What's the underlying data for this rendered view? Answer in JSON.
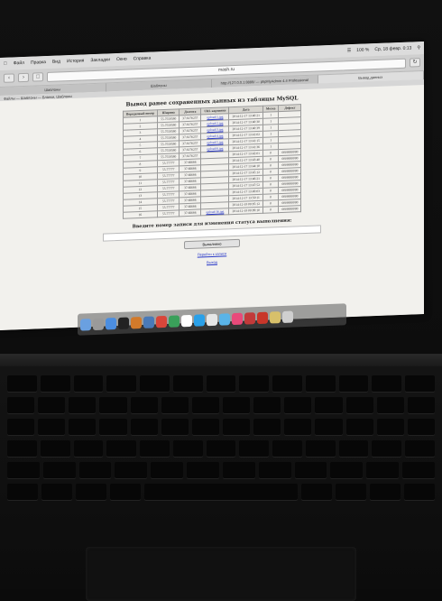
{
  "menubar": {
    "items": [
      "Файл",
      "Правка",
      "Вид",
      "История",
      "Закладки",
      "Окно",
      "Справка"
    ],
    "battery": "100 %",
    "clock": "Ср, 18 февр. 0:13"
  },
  "browser": {
    "address": "mash.ru",
    "tabs": [
      "Шаблоны",
      "Шаблоны",
      "http://127.0.0.1:8888/ — phpMyAdmin 4.4 Professional",
      "Вывод данных"
    ],
    "favorites": "Файлы — Шаблоны — Бланки, Шаблоны"
  },
  "page": {
    "title": "Вывод ранее сохраненных данных из таблицы MySQL",
    "columns": [
      "Порядковый номер",
      "Ширина",
      "Долгота",
      "URL картинки",
      "Дата",
      "Метка",
      "Дефект"
    ],
    "rows": [
      {
        "id": "1",
        "lat": "55.7558580",
        "lon": "37.6176257",
        "url": "upload/1.jpg",
        "date": "2014-12-17 13:40:21",
        "mark": "1",
        "def": ""
      },
      {
        "id": "2",
        "lat": "55.7558580",
        "lon": "37.6176257",
        "url": "upload/2.jpg",
        "date": "2014-12-17 13:40:30",
        "mark": "1",
        "def": ""
      },
      {
        "id": "3",
        "lat": "55.7558580",
        "lon": "37.6176257",
        "url": "upload/3.jpg",
        "date": "2014-12-17 13:40:39",
        "mark": "1",
        "def": ""
      },
      {
        "id": "4",
        "lat": "55.7558580",
        "lon": "37.6176257",
        "url": "upload/4.jpg",
        "date": "2014-12-17 13:41:02",
        "mark": "1",
        "def": ""
      },
      {
        "id": "5",
        "lat": "55.7558580",
        "lon": "37.6176257",
        "url": "upload/5.jpg",
        "date": "2014-12-17 13:41:15",
        "mark": "1",
        "def": ""
      },
      {
        "id": "6",
        "lat": "55.7558580",
        "lon": "37.6176257",
        "url": "upload/6.jpg",
        "date": "2014-12-17 13:41:36",
        "mark": "1",
        "def": ""
      },
      {
        "id": "7",
        "lat": "55.7558580",
        "lon": "37.6176257",
        "url": "",
        "date": "2014-12-17 13:42:01",
        "mark": "0",
        "def": "0000000000"
      },
      {
        "id": "8",
        "lat": "55.77777",
        "lon": "37.66666",
        "url": "",
        "date": "2014-12-17 13:43:40",
        "mark": "0",
        "def": "0000000000"
      },
      {
        "id": "9",
        "lat": "55.77777",
        "lon": "37.66666",
        "url": "",
        "date": "2014-12-17 13:44:10",
        "mark": "0",
        "def": "0000000000"
      },
      {
        "id": "10",
        "lat": "55.77777",
        "lon": "37.66666",
        "url": "",
        "date": "2014-12-17 13:45:12",
        "mark": "0",
        "def": "0000000000"
      },
      {
        "id": "11",
        "lat": "55.77777",
        "lon": "37.66666",
        "url": "",
        "date": "2014-12-17 13:46:21",
        "mark": "0",
        "def": "0000000000"
      },
      {
        "id": "12",
        "lat": "55.77777",
        "lon": "37.66666",
        "url": "",
        "date": "2014-12-17 13:47:52",
        "mark": "0",
        "def": "0000000000"
      },
      {
        "id": "13",
        "lat": "55.77777",
        "lon": "37.66666",
        "url": "",
        "date": "2014-12-17 13:49:03",
        "mark": "0",
        "def": "0000000000"
      },
      {
        "id": "14",
        "lat": "55.77777",
        "lon": "37.66666",
        "url": "",
        "date": "2014-12-17 13:50:11",
        "mark": "0",
        "def": "0000000000"
      },
      {
        "id": "15",
        "lat": "55.77777",
        "lon": "37.66666",
        "url": "",
        "date": "2014-12-18 00:05:12",
        "mark": "0",
        "def": "0000000000"
      },
      {
        "id": "16",
        "lat": "55.77777",
        "lon": "37.66666",
        "url": "upload/16.jpg",
        "date": "2014-12-18 00:09:10",
        "mark": "0",
        "def": "0000000000"
      }
    ],
    "prompt": "Введите номер записи для изменения статуса выполнения:",
    "button_label": "Выполнено",
    "link1": "Перейти к записи",
    "link2": "Выход"
  },
  "dock": {
    "icons": [
      "finder-icon",
      "launchpad-icon",
      "safari-icon",
      "terminal-icon",
      "photos-icon",
      "preview-icon",
      "chrome-icon",
      "maps-icon",
      "calendar-icon",
      "skype-icon",
      "clock-icon",
      "itunes-icon",
      "music-icon",
      "photo-booth-icon",
      "filezilla-icon",
      "documents-icon",
      "trash-icon"
    ],
    "colors": [
      "#6aa0e0",
      "#9a9a9a",
      "#4c8ee0",
      "#222222",
      "#d27a2a",
      "#4a7ab8",
      "#d9463a",
      "#3aa05a",
      "#ffffff",
      "#2aa0e8",
      "#e6e6e6",
      "#5ab4e8",
      "#e84a7a",
      "#c23a3a",
      "#c8362a",
      "#d8c06a",
      "#cfcfcf"
    ]
  }
}
